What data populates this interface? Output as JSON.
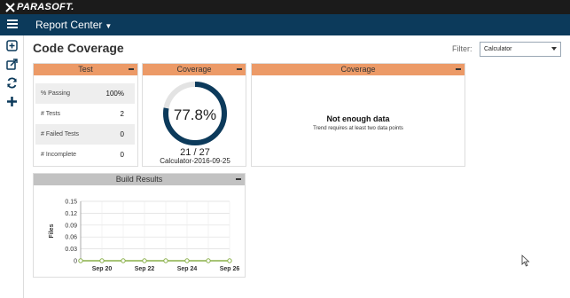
{
  "header": {
    "brand": "PARASOFT.",
    "app_title": "Report Center"
  },
  "sidebar": {
    "icons": [
      "add-widget-icon",
      "export-icon",
      "refresh-icon",
      "add-icon"
    ]
  },
  "page": {
    "title": "Code Coverage",
    "filter_label": "Filter:",
    "filter_value": "Calculator"
  },
  "test_panel": {
    "title": "Test",
    "rows": [
      {
        "label": "% Passing",
        "value": "100%"
      },
      {
        "label": "# Tests",
        "value": "2"
      },
      {
        "label": "# Failed Tests",
        "value": "0"
      },
      {
        "label": "# Incomplete",
        "value": "0"
      }
    ]
  },
  "coverage_panel": {
    "title": "Coverage",
    "percent_label": "77.8%",
    "percent": 0.778,
    "count": "21 / 27",
    "build": "Calculator-2016-09-25",
    "colors": {
      "arc": "#0c3a5b",
      "track": "#e3e3e3"
    }
  },
  "trend_panel": {
    "title": "Coverage",
    "message": "Not enough data",
    "submessage": "Trend requires at least two data points"
  },
  "build_panel": {
    "title": "Build Results"
  },
  "chart_data": {
    "type": "line",
    "title": "",
    "ylabel": "Files",
    "xlabel": "",
    "x": [
      "Sep 19",
      "Sep 20",
      "Sep 21",
      "Sep 22",
      "Sep 23",
      "Sep 24",
      "Sep 25",
      "Sep 26"
    ],
    "x_tick_labels": [
      "Sep 20",
      "Sep 22",
      "Sep 24",
      "Sep 26"
    ],
    "y_tick_labels": [
      "0",
      "0.03",
      "0.06",
      "0.09",
      "0.12",
      "0.15"
    ],
    "ylim": [
      0,
      0.15
    ],
    "grid": true,
    "series": [
      {
        "values": [
          0,
          0,
          0,
          0,
          0,
          0,
          0,
          0
        ],
        "color": "#8ab04a"
      }
    ]
  }
}
